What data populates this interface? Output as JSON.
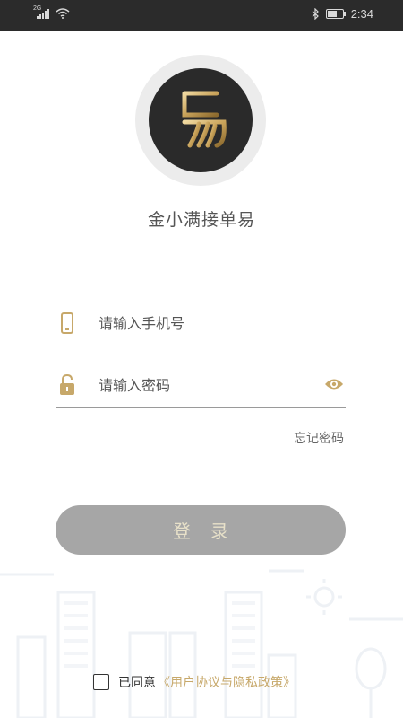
{
  "status_bar": {
    "network": "2G",
    "time": "2:34",
    "battery_level": 0.6
  },
  "app": {
    "name": "金小满接单易",
    "logo_icon": "yi-logo-icon"
  },
  "form": {
    "phone_placeholder": "请输入手机号",
    "password_placeholder": "请输入密码",
    "forgot_password": "忘记密码",
    "login_label": "登录"
  },
  "agreement": {
    "prefix": "已同意",
    "link": "《用户协议与隐私政策》"
  },
  "colors": {
    "accent_gold": "#c7a86a",
    "button_gray": "#a6a6a6",
    "status_bar_bg": "#2b2b2b",
    "logo_bg": "#2a2a2a"
  }
}
